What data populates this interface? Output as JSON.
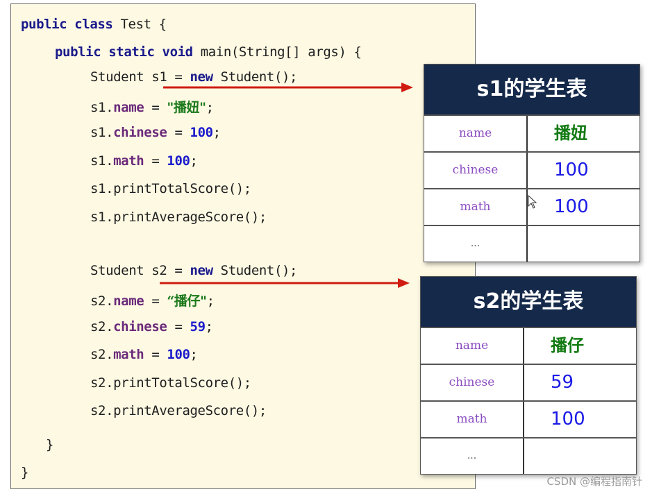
{
  "code": {
    "lines": [
      {
        "tokens": [
          {
            "t": "public class",
            "c": "kw"
          },
          {
            "t": " Test {",
            "c": ""
          }
        ]
      },
      {
        "tokens": [
          {
            "t": "public static void",
            "c": "kw"
          },
          {
            "t": " main(String[] args) {",
            "c": ""
          }
        ]
      },
      {
        "tokens": [
          {
            "t": "Student s1 = ",
            "c": ""
          },
          {
            "t": "new",
            "c": "kw"
          },
          {
            "t": " Student();",
            "c": ""
          }
        ]
      },
      {
        "tokens": [
          {
            "t": "s1.",
            "c": ""
          },
          {
            "t": "name",
            "c": "fld"
          },
          {
            "t": " = ",
            "c": ""
          },
          {
            "t": "\"播妞\"",
            "c": "str"
          },
          {
            "t": ";",
            "c": ""
          }
        ]
      },
      {
        "tokens": [
          {
            "t": "s1.",
            "c": ""
          },
          {
            "t": "chinese",
            "c": "fld"
          },
          {
            "t": " = ",
            "c": ""
          },
          {
            "t": "100",
            "c": "num"
          },
          {
            "t": ";",
            "c": ""
          }
        ]
      },
      {
        "tokens": [
          {
            "t": "s1.",
            "c": ""
          },
          {
            "t": "math",
            "c": "fld"
          },
          {
            "t": " = ",
            "c": ""
          },
          {
            "t": "100",
            "c": "num"
          },
          {
            "t": ";",
            "c": ""
          }
        ]
      },
      {
        "tokens": [
          {
            "t": "s1.printTotalScore();",
            "c": ""
          }
        ]
      },
      {
        "tokens": [
          {
            "t": "s1.printAverageScore();",
            "c": ""
          }
        ]
      },
      {
        "tokens": [
          {
            "t": "Student s2 = ",
            "c": ""
          },
          {
            "t": "new",
            "c": "kw"
          },
          {
            "t": " Student();",
            "c": ""
          }
        ]
      },
      {
        "tokens": [
          {
            "t": "s2.",
            "c": ""
          },
          {
            "t": "name",
            "c": "fld"
          },
          {
            "t": " = ",
            "c": ""
          },
          {
            "t": "“播仔\"",
            "c": "str"
          },
          {
            "t": ";",
            "c": ""
          }
        ]
      },
      {
        "tokens": [
          {
            "t": "s2.",
            "c": ""
          },
          {
            "t": "chinese",
            "c": "fld"
          },
          {
            "t": " = ",
            "c": ""
          },
          {
            "t": "59",
            "c": "num"
          },
          {
            "t": ";",
            "c": ""
          }
        ]
      },
      {
        "tokens": [
          {
            "t": "s2.",
            "c": ""
          },
          {
            "t": "math",
            "c": "fld"
          },
          {
            "t": " = ",
            "c": ""
          },
          {
            "t": "100",
            "c": "num"
          },
          {
            "t": ";",
            "c": ""
          }
        ]
      },
      {
        "tokens": [
          {
            "t": "s2.printTotalScore();",
            "c": ""
          }
        ]
      },
      {
        "tokens": [
          {
            "t": "s2.printAverageScore();",
            "c": ""
          }
        ]
      },
      {
        "tokens": [
          {
            "t": "}",
            "c": ""
          }
        ]
      },
      {
        "tokens": [
          {
            "t": "}",
            "c": ""
          }
        ]
      }
    ]
  },
  "tables": [
    {
      "title": "s1的学生表",
      "rows": [
        {
          "key": "name",
          "value": "播妞"
        },
        {
          "key": "chinese",
          "value": "100"
        },
        {
          "key": "math",
          "value": "100"
        },
        {
          "key": "...",
          "value": ""
        }
      ]
    },
    {
      "title": "s2的学生表",
      "rows": [
        {
          "key": "name",
          "value": "播仔"
        },
        {
          "key": "chinese",
          "value": "59"
        },
        {
          "key": "math",
          "value": "100"
        },
        {
          "key": "...",
          "value": ""
        }
      ]
    }
  ],
  "colors": {
    "panel_bg": "#fdf9e3",
    "table_header": "#15294a",
    "arrow": "#d01c10",
    "keyword": "#1a1a8c",
    "field": "#6b2a7a",
    "number": "#1a1acc",
    "string": "#1c7a1c"
  },
  "watermark": "CSDN @编程指南针"
}
